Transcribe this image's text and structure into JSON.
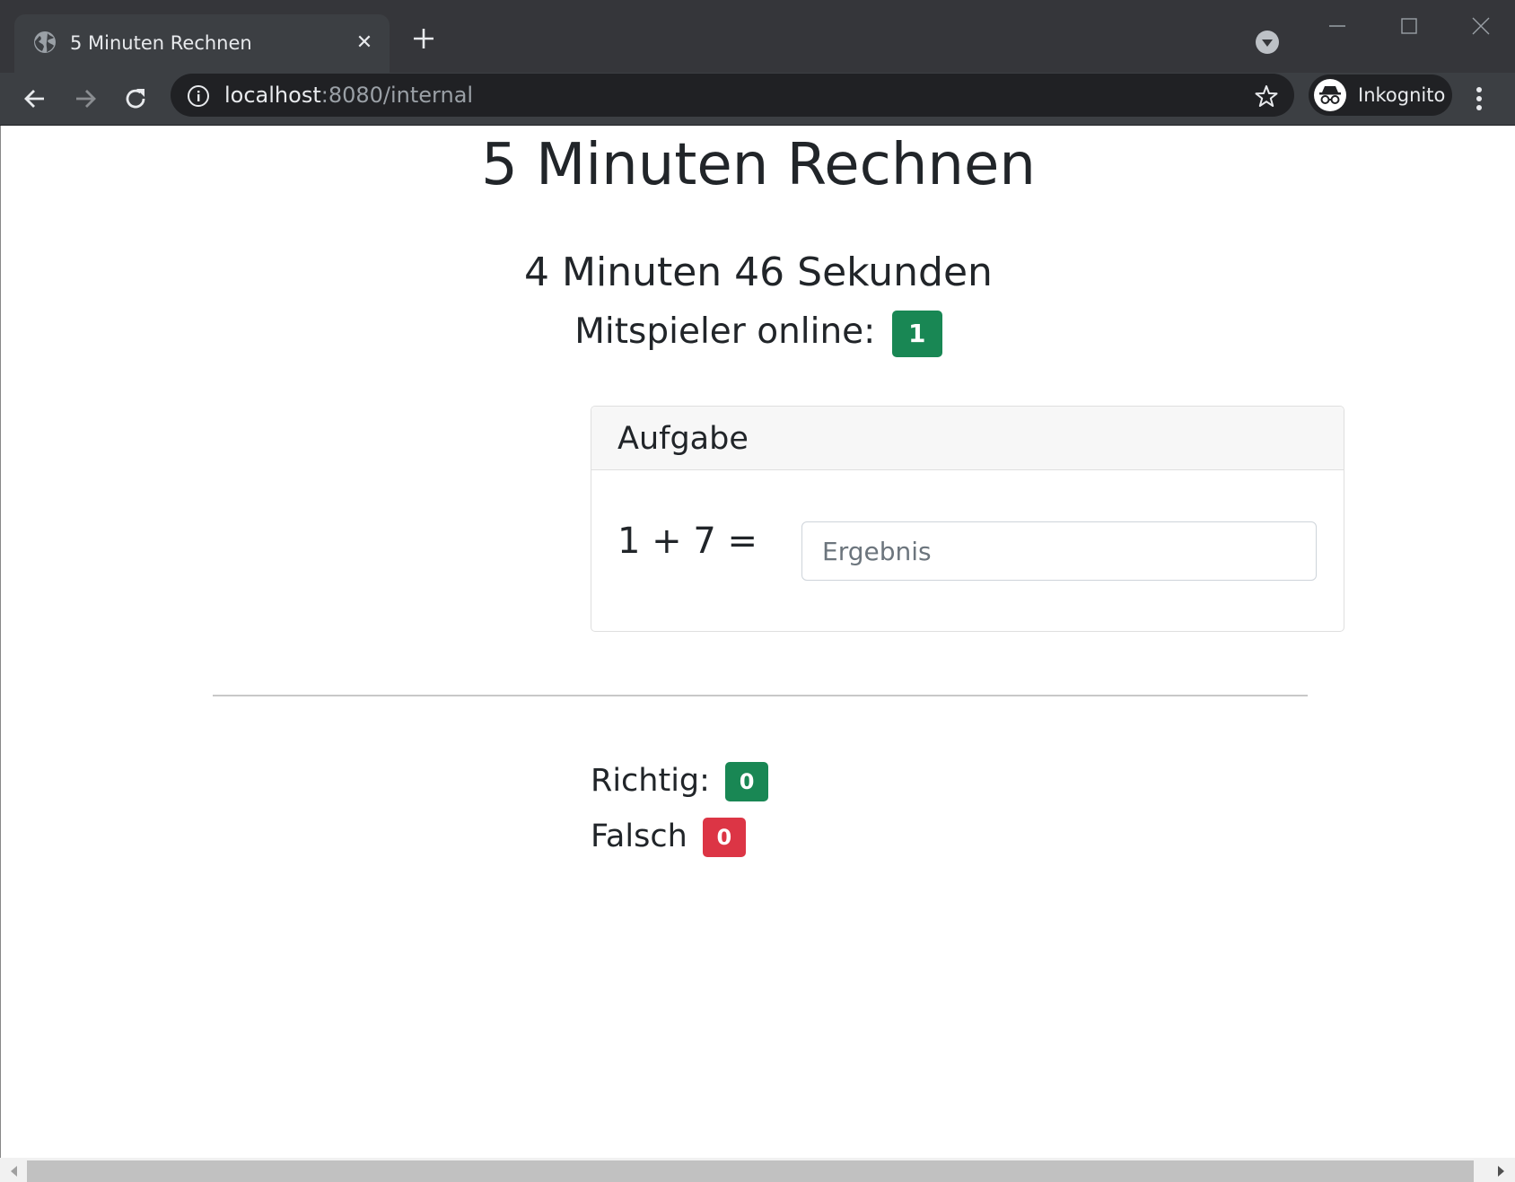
{
  "browser": {
    "tab_title": "5 Minuten Rechnen",
    "url_host": "localhost",
    "url_rest": ":8080/internal",
    "profile_label": "Inkognito"
  },
  "page": {
    "heading": "5 Minuten Rechnen",
    "timer": "4 Minuten 46 Sekunden",
    "players_label": "Mitspieler online:",
    "players_count": "1",
    "card_title": "Aufgabe",
    "equation": "1 + 7 =",
    "answer_value": "",
    "answer_placeholder": "Ergebnis",
    "correct_label": "Richtig:",
    "correct_count": "0",
    "wrong_label": "Falsch",
    "wrong_count": "0"
  },
  "colors": {
    "success": "#198754",
    "danger": "#dc3545",
    "chrome_dark": "#35363a"
  }
}
